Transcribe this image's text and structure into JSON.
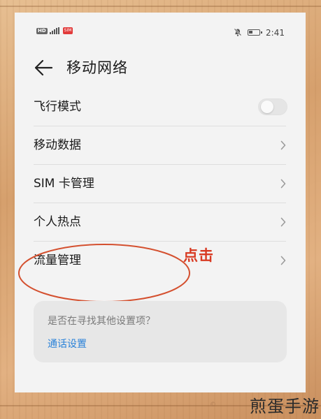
{
  "status_bar": {
    "network_badge": "HD",
    "sim_badge": "SIM",
    "time": "2:41",
    "battery_level": 0.4,
    "icons": [
      "hd-icon",
      "signal-icon",
      "sim-icon",
      "mute-icon",
      "battery-icon"
    ]
  },
  "header": {
    "title": "移动网络",
    "back_icon": "arrow-left-icon"
  },
  "rows": [
    {
      "label": "飞行模式",
      "control": "toggle",
      "toggle_on": false
    },
    {
      "label": "移动数据",
      "control": "chevron"
    },
    {
      "label": "SIM 卡管理",
      "control": "chevron"
    },
    {
      "label": "个人热点",
      "control": "chevron"
    },
    {
      "label": "流量管理",
      "control": "chevron",
      "highlighted": true
    }
  ],
  "suggestion": {
    "question": "是否在寻找其他设置项？",
    "link": "通话设置"
  },
  "annotation": {
    "text": "点击",
    "color": "#d83a22"
  },
  "watermark": {
    "mark": "©",
    "logo_text": "煎蛋手游"
  },
  "colors": {
    "link": "#2a82d8",
    "screen_bg": "#f3f3f3"
  }
}
